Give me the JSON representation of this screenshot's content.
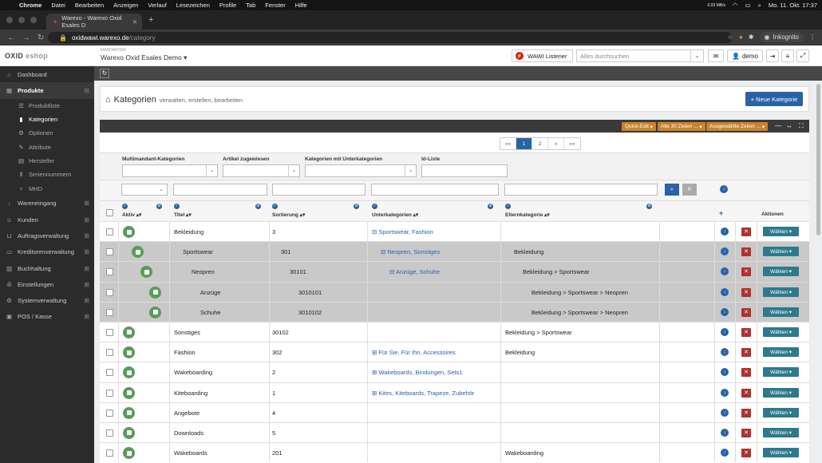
{
  "macbar": {
    "app": "Chrome",
    "menus": [
      "Datei",
      "Bearbeiten",
      "Anzeigen",
      "Verlauf",
      "Lesezeichen",
      "Profile",
      "Tab",
      "Fenster",
      "Hilfe"
    ],
    "datetime": "Mo. 11. Okt.  17:37",
    "net": "0.03 MB/s"
  },
  "browser": {
    "tab_title": "Warexo - Warexo Oxid Esales D",
    "url_host": "oxidwawi.warexo.de",
    "url_path": "/category",
    "incognito": "Inkognito"
  },
  "header": {
    "logo": "OXID",
    "logo2": "eshop",
    "mandant_label": "MANDANTEN",
    "mandant_value": "Warexo Oxid Esales Demo",
    "wawi": "WAWI Listener",
    "search_placeholder": "Alles durchsuchen",
    "user": "demo"
  },
  "sidebar": {
    "items": [
      {
        "label": "Dashboard"
      },
      {
        "label": "Produkte"
      },
      {
        "label": "Wareneingang"
      },
      {
        "label": "Kunden"
      },
      {
        "label": "Auftragsverwaltung"
      },
      {
        "label": "Kreditorenverwaltung"
      },
      {
        "label": "Buchhaltung"
      },
      {
        "label": "Einstellungen"
      },
      {
        "label": "Systemverwaltung"
      },
      {
        "label": "POS / Kasse"
      }
    ],
    "sub": [
      {
        "label": "Produktliste"
      },
      {
        "label": "Kategorien"
      },
      {
        "label": "Optionen"
      },
      {
        "label": "Attribute"
      },
      {
        "label": "Hersteller"
      },
      {
        "label": "Seriennummern"
      },
      {
        "label": "MHD"
      }
    ]
  },
  "page": {
    "title": "Kategorien",
    "subtitle": "verwalten, erstellen, bearbeiten",
    "new_button": "+ Neue Kategorie"
  },
  "toolbar": {
    "quick": "Quick-Edit",
    "all": "Alle 30 Zeilen ...",
    "selected": "Ausgewählte Zeilen ..."
  },
  "pagination": [
    "««",
    "1",
    "2",
    "»",
    "»»"
  ],
  "filters": {
    "multimandant": "Multimandant-Kategorien",
    "artikel": "Artikel zugewiesen",
    "mitunter": "Kategorien mit Unterkategorien",
    "idliste": "Id-Liste",
    "reset": "R"
  },
  "columns": {
    "aktiv": "Aktiv",
    "titel": "Titel",
    "sortierung": "Sortierung",
    "unter": "Unterkategorien",
    "eltern": "Elternkategorie",
    "aktionen": "Aktionen",
    "add": "+"
  },
  "rows": [
    {
      "title": "Bekleidung",
      "sort": "3",
      "sub": "⊟ Sportswear, Fashion",
      "parent": "",
      "level": 0
    },
    {
      "title": "Sportswear",
      "sort": "301",
      "sub": "⊟ Neopren, Sonstiges",
      "parent": "Bekleidung",
      "level": 1
    },
    {
      "title": "Neopren",
      "sort": "30101",
      "sub": "⊟ Anzüge, Schuhe",
      "parent": "Bekleidung > Sportswear",
      "level": 2
    },
    {
      "title": "Anzüge",
      "sort": "3010101",
      "sub": "",
      "parent": "Bekleidung > Sportswear > Neopren",
      "level": 3
    },
    {
      "title": "Schuhe",
      "sort": "3010102",
      "sub": "",
      "parent": "Bekleidung > Sportswear > Neopren",
      "level": 3
    },
    {
      "title": "Sonstiges",
      "sort": "30102",
      "sub": "",
      "parent": "Bekleidung > Sportswear",
      "level": 0
    },
    {
      "title": "Fashion",
      "sort": "302",
      "sub": "⊞ Für Sie, Für Ihn, Accessoires",
      "parent": "Bekleidung",
      "level": 0
    },
    {
      "title": "Wakeboarding",
      "sort": "2",
      "sub": "⊞ Wakeboards, Bindungen, Sets1",
      "parent": "",
      "level": 0
    },
    {
      "title": "Kiteboarding",
      "sort": "1",
      "sub": "⊞ Kites, Kiteboards, Trapeze, Zubehör",
      "parent": "",
      "level": 0
    },
    {
      "title": "Angebote",
      "sort": "4",
      "sub": "",
      "parent": "",
      "level": 0
    },
    {
      "title": "Downloads",
      "sort": "5",
      "sub": "",
      "parent": "",
      "level": 0
    },
    {
      "title": "Wakeboards",
      "sort": "201",
      "sub": "",
      "parent": "Wakeboarding",
      "level": 0
    }
  ],
  "row_button": "Wählen ▾",
  "colors": {
    "accent": "#2a62a6",
    "active_green": "#5b9a5b",
    "delete_red": "#b03030",
    "orange": "#c8842d",
    "sidebar": "#2b2b2b"
  }
}
